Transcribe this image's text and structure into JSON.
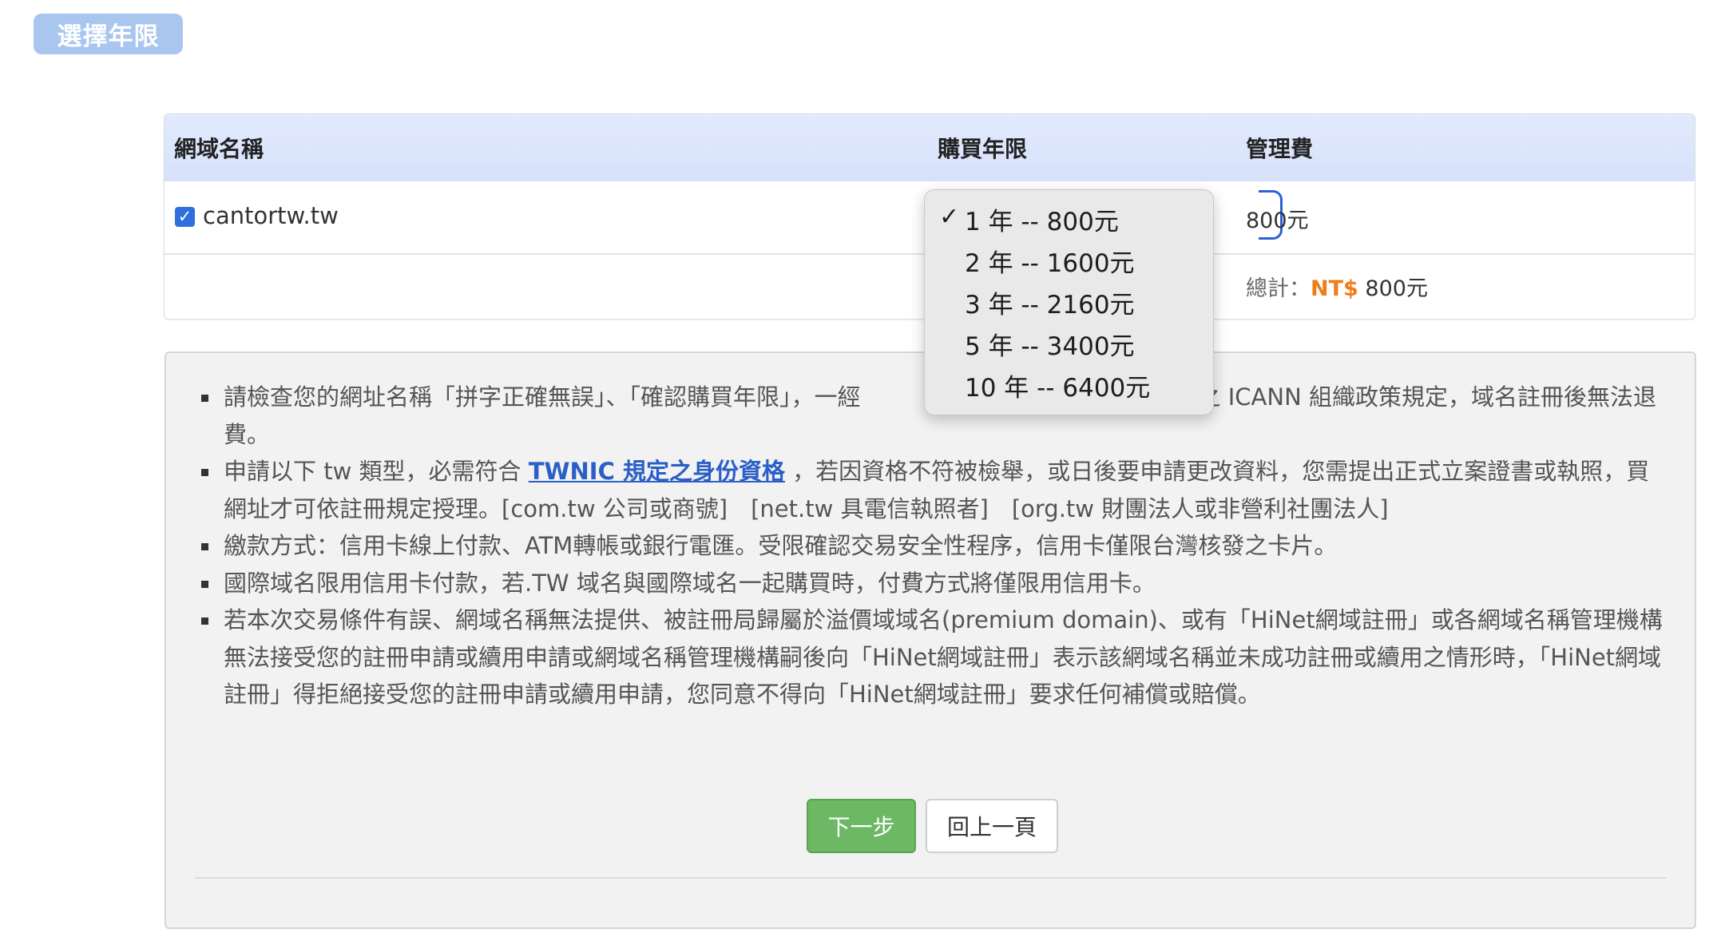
{
  "step_badge": "選擇年限",
  "table": {
    "headers": {
      "domain": "網域名稱",
      "years": "購買年限",
      "fee": "管理費"
    },
    "row": {
      "checked": true,
      "domain": "cantortw.tw",
      "fee": "800元"
    },
    "total": {
      "label": "總計：",
      "currency": "NT$",
      "amount": "800元"
    }
  },
  "dropdown": {
    "selected_index": 0,
    "options": [
      "1 年 -- 800元",
      "2 年 -- 1600元",
      "3 年 -- 2160元",
      "5 年 -- 3400元",
      "10 年 -- 6400元"
    ]
  },
  "notice": {
    "item1_a": "請檢查您的網址名稱「拼字正確無誤」、「確認購買年限」，一經",
    "item1_b": "域名之 ICANN 組織政策規定，域名註冊後無法退費。",
    "item2_pre": "申請以下 tw 類型，必需符合 ",
    "item2_link": "TWNIC 規定之身份資格",
    "item2_post": " ，若因資格不符被檢舉，或日後要申請更改資料，您需提出正式立案證書或執照，買網址才可依註冊規定授理。[com.tw 公司或商號]　[net.tw 具電信執照者]　[org.tw 財團法人或非營利社團法人]",
    "item3": "繳款方式：信用卡線上付款、ATM轉帳或銀行電匯。受限確認交易安全性程序，信用卡僅限台灣核發之卡片。",
    "item4": "國際域名限用信用卡付款，若.TW 域名與國際域名一起購買時，付費方式將僅限用信用卡。",
    "item5": "若本次交易條件有誤、網域名稱無法提供、被註冊局歸屬於溢價域域名(premium domain)、或有「HiNet網域註冊」或各網域名稱管理機構無法接受您的註冊申請或續用申請或網域名稱管理機構嗣後向「HiNet網域註冊」表示該網域名稱並未成功註冊或續用之情形時，「HiNet網域註冊」得拒絕接受您的註冊申請或續用申請，您同意不得向「HiNet網域註冊」要求任何補償或賠償。"
  },
  "buttons": {
    "next": "下一步",
    "back": "回上一頁"
  }
}
